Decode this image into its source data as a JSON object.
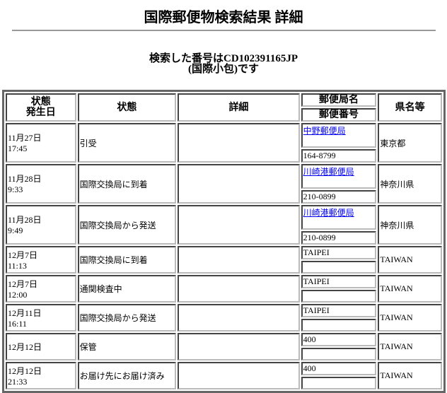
{
  "title": "国際郵便物検索結果 詳細",
  "search": {
    "line1": "検索した番号はCD102391165JP",
    "line2": "(国際小包)です"
  },
  "headers": {
    "date_line1": "状態",
    "date_line2": "発生日",
    "status": "状態",
    "detail": "詳細",
    "office": "郵便局名",
    "postcode": "郵便番号",
    "prefecture": "県名等"
  },
  "rows": [
    {
      "date": "11月27日",
      "time": "17:45",
      "status": "引受",
      "detail": "",
      "office": "中野郵便局",
      "office_link": true,
      "postcode": "164-8799",
      "prefecture": "東京都"
    },
    {
      "date": "11月28日",
      "time": "9:33",
      "status": "国際交換局に到着",
      "detail": "",
      "office": "川崎港郵便局",
      "office_link": true,
      "postcode": "210-0899",
      "prefecture": "神奈川県"
    },
    {
      "date": "11月28日",
      "time": "9:49",
      "status": "国際交換局から発送",
      "detail": "",
      "office": "川崎港郵便局",
      "office_link": true,
      "postcode": "210-0899",
      "prefecture": "神奈川県"
    },
    {
      "date": "12月7日",
      "time": "11:13",
      "status": "国際交換局に到着",
      "detail": "",
      "office": "TAIPEI",
      "office_link": false,
      "postcode": "",
      "prefecture": "TAIWAN"
    },
    {
      "date": "12月7日",
      "time": "12:00",
      "status": "通関検査中",
      "detail": "",
      "office": "TAIPEI",
      "office_link": false,
      "postcode": "",
      "prefecture": "TAIWAN"
    },
    {
      "date": "12月11日",
      "time": "16:11",
      "status": "国際交換局から発送",
      "detail": "",
      "office": "TAIPEI",
      "office_link": false,
      "postcode": "",
      "prefecture": "TAIWAN"
    },
    {
      "date": "12月12日",
      "time": "",
      "status": "保管",
      "detail": "",
      "office": "400",
      "office_link": false,
      "postcode": "",
      "prefecture": "TAIWAN"
    },
    {
      "date": "12月12日",
      "time": "21:33",
      "status": "お届け先にお届け済み",
      "detail": "",
      "office": "400",
      "office_link": false,
      "postcode": "",
      "prefecture": "TAIWAN"
    }
  ]
}
